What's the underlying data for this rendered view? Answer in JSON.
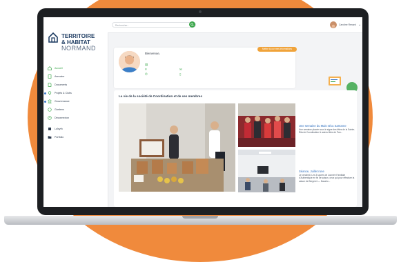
{
  "brand": {
    "logo_line1": "TERRITOIRE",
    "logo_line2": "& HABITAT",
    "logo_line3": "NORMAND",
    "colors": {
      "navy": "#1f3d63",
      "green": "#3aa64a",
      "orange": "#f08a3c",
      "link": "#2f6fbf"
    }
  },
  "sidebar": {
    "items": [
      {
        "label": "Accueil",
        "icon": "home-icon",
        "active": true
      },
      {
        "label": "Annuaire",
        "icon": "book-icon"
      },
      {
        "label": "Documents",
        "icon": "document-icon"
      },
      {
        "label": "Projets & Clubs",
        "icon": "lightbulb-icon"
      },
      {
        "label": "Gouvernance",
        "icon": "governance-icon"
      },
      {
        "label": "Gardens",
        "icon": "garden-icon"
      },
      {
        "label": "Déconnexion",
        "icon": "logout-icon"
      }
    ],
    "secondary": [
      {
        "label": "Loïsyth",
        "icon": "book-icon"
      },
      {
        "label": "Portfolio",
        "icon": "folder-icon"
      }
    ]
  },
  "topbar": {
    "search_placeholder": "Rechercher...",
    "user_name": "Caroline Renard"
  },
  "welcome": {
    "title": "Bienvenue,",
    "edit_button": "Mettre à jour mes informations"
  },
  "news": {
    "heading": "La vie de la société de Coordination et de ses membres",
    "articles": [
      {
        "title": "Une semaine du Mais sécu Sartonne",
        "text": "Une semaine placée sous le signe des fêtes de la Sainte-Rita de Coordination & autres fêtes de Pan..."
      },
      {
        "title": "Séance, Juillet rune",
        "text": "Le vendredi, Les 3 spores de Journée Familiale d’Authentique en fin de saison, ceux qui pour effectuer la saison de Bergeret — Dacarlo..."
      }
    ]
  }
}
